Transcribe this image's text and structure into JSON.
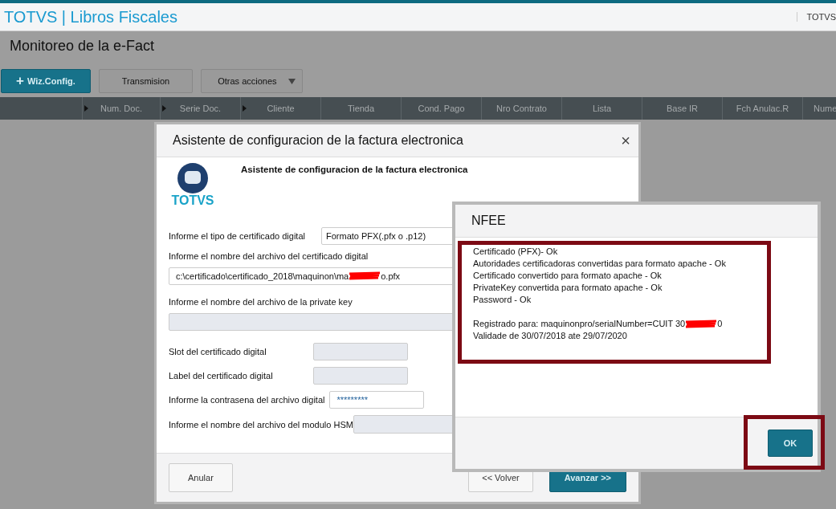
{
  "app_header": {
    "title": "TOTVS | Libros Fiscales",
    "user": "TOTVS"
  },
  "page": {
    "title": "Monitoreo de la e-Fact"
  },
  "toolbar": [
    {
      "label": "Wiz.Config.",
      "kind": "primary",
      "icon": "+"
    },
    {
      "label": "Transmision",
      "kind": "plain"
    },
    {
      "label": "Otras acciones",
      "kind": "dropdown"
    }
  ],
  "table": {
    "columns": [
      {
        "label": "Num. Doc.",
        "arrow": true
      },
      {
        "label": "Serie Doc.",
        "arrow": true
      },
      {
        "label": "Cliente",
        "arrow": true
      },
      {
        "label": "Tienda",
        "arrow": false
      },
      {
        "label": "Cond. Pago",
        "arrow": false
      },
      {
        "label": "Nro Contrato",
        "arrow": false
      },
      {
        "label": "Lista",
        "arrow": false
      },
      {
        "label": "Base IR",
        "arrow": false
      },
      {
        "label": "Fch Anulac.R",
        "arrow": false
      },
      {
        "label": "Nume",
        "arrow": false
      }
    ]
  },
  "wizard": {
    "title": "Asistente de configuracion de la factura electronica",
    "close": "×",
    "logo_text": "TOTVS",
    "heading": "Asistente de configuracion de la factura electronica",
    "fields": [
      {
        "label": "Informe el tipo de certificado digital",
        "kind": "select",
        "value_parts": [
          "Formato PFX(.pfx o .p12)"
        ],
        "disabled": false
      },
      {
        "label": "Informe el nombre del archivo del certificado digital",
        "kind": "text",
        "value_parts": [
          "c:\\certificado\\certificado_2018\\maquinon\\ma",
          "o.pfx"
        ],
        "disabled": false
      },
      {
        "label": "Informe el nombre del archivo de la private key",
        "kind": "text",
        "disabled": true
      },
      {
        "label": "Slot del certificado digital",
        "kind": "text",
        "disabled": true
      },
      {
        "label": "Label del certificado digital",
        "kind": "text",
        "disabled": true
      },
      {
        "label": "Informe la contrasena del archivo digital",
        "kind": "password",
        "value_parts": [
          "*********"
        ],
        "disabled": false
      },
      {
        "label": "Informe el nombre del archivo del modulo HSM",
        "kind": "text",
        "disabled": true
      }
    ],
    "buttons": [
      {
        "label": "Anular",
        "kind": "plain"
      },
      {
        "label": "<< Volver",
        "kind": "plain"
      },
      {
        "label": "Avanzar >>",
        "kind": "primary"
      }
    ]
  },
  "message_dialog": {
    "title": "NFEE",
    "status_lines": [
      {
        "parts": [
          "Certificado (PFX)- Ok"
        ]
      },
      {
        "parts": [
          "Autoridades certificadoras convertidas para formato apache - Ok"
        ]
      },
      {
        "parts": [
          "Certificado convertido para formato apache - Ok"
        ]
      },
      {
        "parts": [
          "PrivateKey convertida para formato apache - Ok"
        ]
      },
      {
        "parts": [
          "Password - Ok"
        ]
      }
    ],
    "registration_lines": [
      {
        "parts": [
          "Registrado para: maquinonpro/serialNumber=CUIT 30",
          "0"
        ]
      },
      {
        "parts": [
          "Validade de 30/07/2018 ate 29/07/2020"
        ]
      }
    ],
    "button": {
      "label": "OK"
    }
  }
}
